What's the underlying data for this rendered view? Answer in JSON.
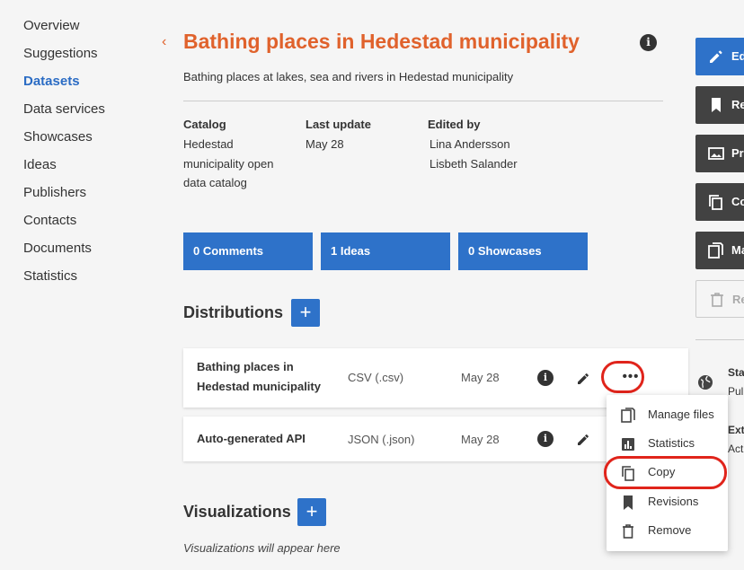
{
  "sidebar": {
    "items": [
      "Overview",
      "Suggestions",
      "Datasets",
      "Data services",
      "Showcases",
      "Ideas",
      "Publishers",
      "Contacts",
      "Documents",
      "Statistics"
    ],
    "active": "Datasets"
  },
  "header": {
    "back_glyph": "‹",
    "title": "Bathing places in Hedestad municipality",
    "info_glyph": "i",
    "subtitle": "Bathing places at lakes, sea and rivers in Hedestad municipality"
  },
  "meta": {
    "catalog_label": "Catalog",
    "catalog_lines": [
      "Hedestad",
      "municipality open",
      "data catalog"
    ],
    "last_update_label": "Last update",
    "last_update_value": "May 28",
    "edited_by_label": "Edited by",
    "edited_by_values": [
      "Lina Andersson",
      "Lisbeth Salander"
    ]
  },
  "tiles": [
    "0 Comments",
    "1 Ideas",
    "0 Showcases"
  ],
  "distributions": {
    "heading": "Distributions",
    "rows": [
      {
        "name_lines": [
          "Bathing places in",
          "Hedestad municipality"
        ],
        "format": "CSV (.csv)",
        "date": "May 28"
      },
      {
        "name_lines": [
          "Auto-generated API"
        ],
        "format": "JSON (.json)",
        "date": "May 28"
      }
    ],
    "more_glyph": "•••"
  },
  "menu": {
    "items": [
      "Manage files",
      "Statistics",
      "Copy",
      "Revisions",
      "Remove"
    ],
    "icons": [
      "files-icon",
      "bar-chart-icon",
      "copy-icon",
      "bookmark-icon",
      "trash-icon"
    ]
  },
  "visualizations": {
    "heading": "Visualizations",
    "empty_text": "Visualizations will appear here"
  },
  "actions": [
    "Ed",
    "Re",
    "Pr",
    "Co",
    "Ma",
    "Re"
  ],
  "side_info": {
    "status_label": "Sta",
    "status_value": "Pul",
    "ext_label": "Ext",
    "ext_value": "Act"
  },
  "plus_glyph": "+",
  "colors": {
    "accent": "#2e72c9",
    "title": "#e0622c",
    "highlight": "#e0241b",
    "dark_button": "#424242"
  }
}
